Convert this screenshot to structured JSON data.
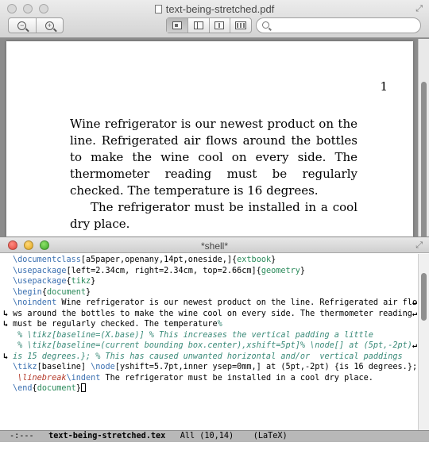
{
  "pdf_viewer": {
    "title": "text-being-stretched.pdf",
    "search": {
      "placeholder": "",
      "value": ""
    },
    "page": {
      "number": "1",
      "paragraphs": [
        "Wine refrigerator is our newest product on the line. Refrigerated air flows around the bottles to make the wine cool on every side. The thermometer reading must be regularly checked. The temperature is 16 degrees.",
        "The refrigerator must be installed in a cool dry place."
      ]
    }
  },
  "emacs": {
    "title": "*shell*",
    "lines": [
      {
        "wrap_in": "",
        "wrap_out": "",
        "tokens": [
          {
            "t": "\\documentclass",
            "c": "kw"
          },
          {
            "t": "[a5paper,openany,14pt,oneside,]",
            "c": ""
          },
          {
            "t": "{",
            "c": ""
          },
          {
            "t": "extbook",
            "c": "arg"
          },
          {
            "t": "}",
            "c": ""
          }
        ]
      },
      {
        "wrap_in": "",
        "wrap_out": "",
        "tokens": [
          {
            "t": "\\usepackage",
            "c": "kw"
          },
          {
            "t": "[left=2.34cm, right=2.34cm, top=2.66cm]",
            "c": ""
          },
          {
            "t": "{",
            "c": ""
          },
          {
            "t": "geometry",
            "c": "arg"
          },
          {
            "t": "}",
            "c": ""
          }
        ]
      },
      {
        "wrap_in": "",
        "wrap_out": "",
        "tokens": [
          {
            "t": "\\usepackage",
            "c": "kw"
          },
          {
            "t": "{",
            "c": ""
          },
          {
            "t": "tikz",
            "c": "arg"
          },
          {
            "t": "}",
            "c": ""
          }
        ]
      },
      {
        "wrap_in": "",
        "wrap_out": "",
        "tokens": [
          {
            "t": "\\begin",
            "c": "kw"
          },
          {
            "t": "{",
            "c": ""
          },
          {
            "t": "document",
            "c": "arg"
          },
          {
            "t": "}",
            "c": ""
          }
        ]
      },
      {
        "wrap_in": "",
        "wrap_out": "↵",
        "tokens": [
          {
            "t": "\\noindent",
            "c": "kw"
          },
          {
            "t": " Wine refrigerator is our newest product on the line. Refrigerated air flo",
            "c": ""
          }
        ]
      },
      {
        "wrap_in": "↳",
        "wrap_out": "↵",
        "tokens": [
          {
            "t": "ws around the bottles to make the wine cool on every side. The thermometer reading ",
            "c": ""
          }
        ]
      },
      {
        "wrap_in": "↳",
        "wrap_out": "",
        "tokens": [
          {
            "t": "must be regularly checked. The temperature",
            "c": ""
          },
          {
            "t": "%",
            "c": "comment"
          }
        ]
      },
      {
        "wrap_in": "",
        "wrap_out": "",
        "tokens": [
          {
            "t": " % \\tikz[baseline=(X.base)] % This increases the vertical padding a little",
            "c": "comment"
          }
        ]
      },
      {
        "wrap_in": "",
        "wrap_out": "↵",
        "tokens": [
          {
            "t": " % \\tikz[baseline=(current bounding box.center),xshift=5pt]% \\node[] at (5pt,-2pt) {",
            "c": "comment"
          }
        ]
      },
      {
        "wrap_in": "↳",
        "wrap_out": "",
        "tokens": [
          {
            "t": "is 15 degrees.}; % This has caused unwanted horizontal and/or  vertical paddings",
            "c": "comment"
          }
        ]
      },
      {
        "wrap_in": "",
        "wrap_out": "",
        "tokens": [
          {
            "t": "\\tikz",
            "c": "kw"
          },
          {
            "t": "[baseline] ",
            "c": ""
          },
          {
            "t": "\\node",
            "c": "kw"
          },
          {
            "t": "[yshift=5.7pt,inner ysep=0mm,] at (5pt,-2pt) {is 16 degrees.};",
            "c": ""
          }
        ]
      },
      {
        "wrap_in": "",
        "wrap_out": "",
        "tokens": [
          {
            "t": " \\linebreak",
            "c": "break"
          },
          {
            "t": "\\indent",
            "c": "kw"
          },
          {
            "t": " The refrigerator must be installed in a cool dry place.",
            "c": ""
          }
        ]
      },
      {
        "wrap_in": "",
        "wrap_out": "",
        "cursor": true,
        "tokens": [
          {
            "t": "\\end",
            "c": "kw"
          },
          {
            "t": "{",
            "c": ""
          },
          {
            "t": "document",
            "c": "arg"
          },
          {
            "t": "}",
            "c": ""
          }
        ]
      }
    ],
    "modeline": {
      "status": "-:---",
      "buffer": "text-being-stretched.tex",
      "position": "All (10,14)",
      "mode": "(LaTeX)"
    }
  },
  "colors": {
    "keyword": "#3a6fb0",
    "argument": "#2a8a5a",
    "comment": "#3a8a78",
    "linebreak": "#b33a2a",
    "modeline_bg": "#b8b8b8"
  },
  "icons": [
    "zoom-out-icon",
    "zoom-in-icon",
    "single-page-icon",
    "sidebar-icon",
    "thumbnails-icon",
    "contact-sheet-icon",
    "search-icon",
    "fullscreen-icon",
    "document-icon"
  ]
}
